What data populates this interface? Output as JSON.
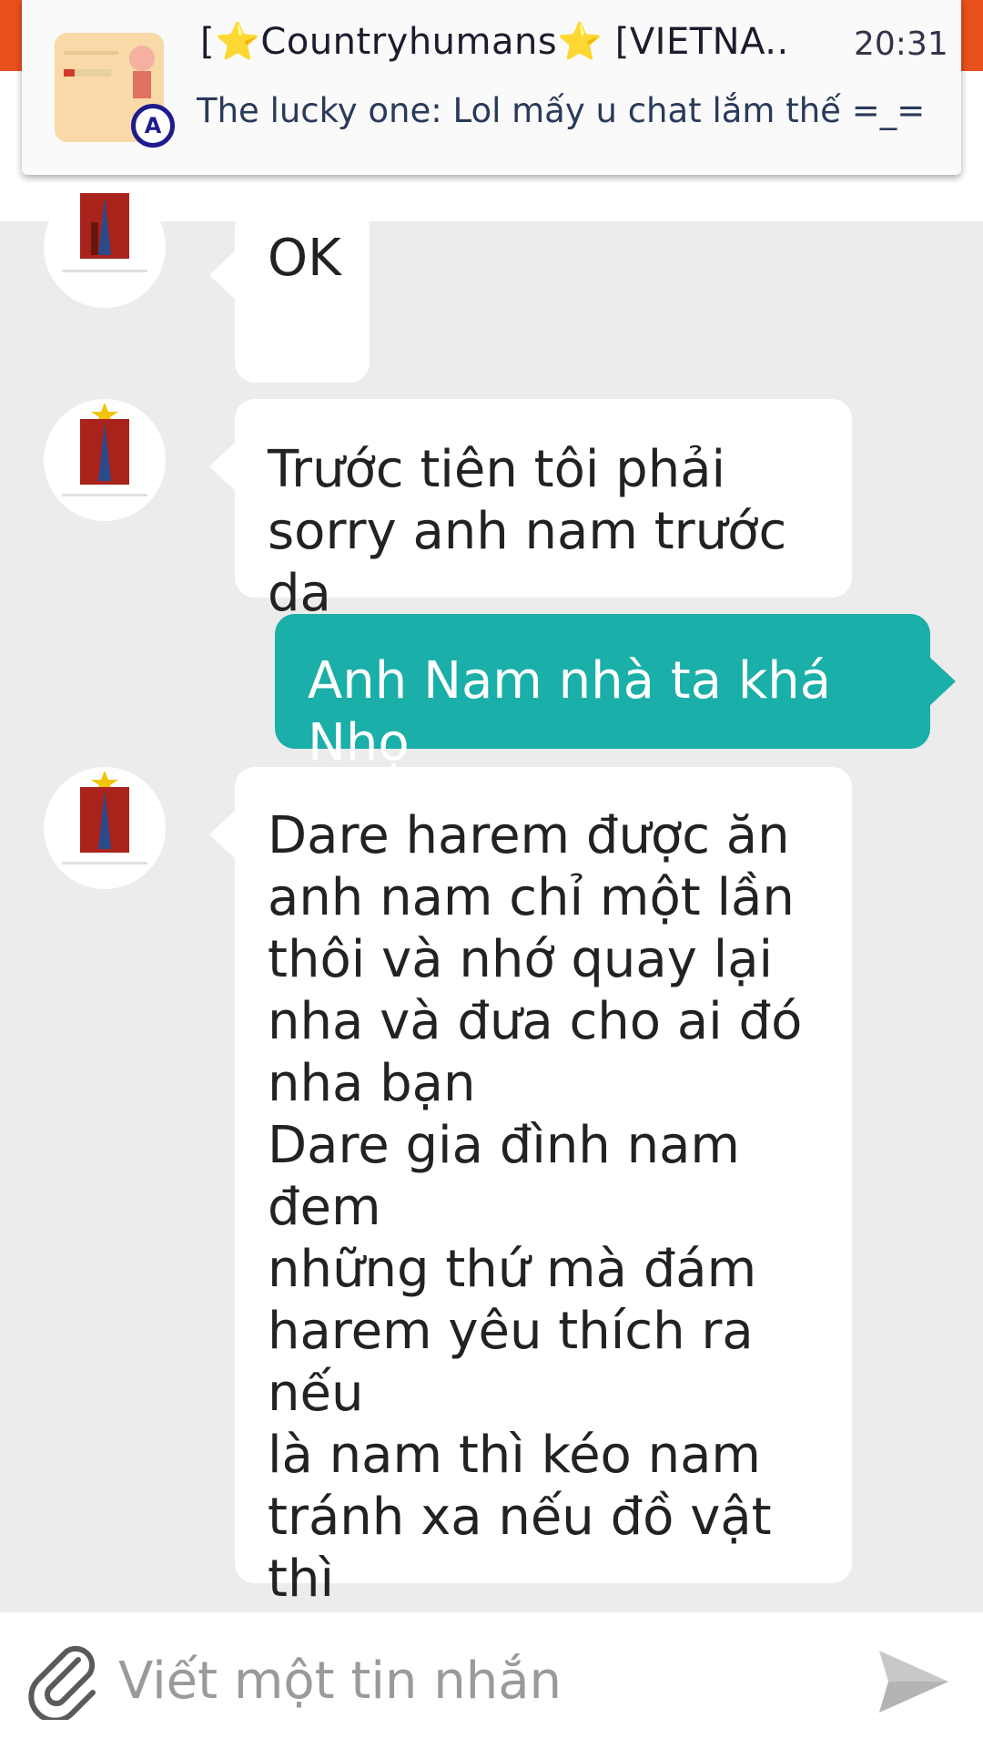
{
  "notification": {
    "title": "[⭐Countryhumans⭐ [VIETNA..",
    "time": "20:31",
    "body": "The lucky one: Lol mấy u chat lắm thế =_=",
    "badge": "A"
  },
  "messages": [
    {
      "direction": "in",
      "text": "OK"
    },
    {
      "direction": "in",
      "text": "Trước tiên tôi phải\nsorry anh nam trước da"
    },
    {
      "direction": "out",
      "text": "Anh Nam nhà ta khá Nhọ"
    },
    {
      "direction": "in",
      "text": "Dare harem được ăn\nanh nam chỉ một lần\nthôi và nhớ quay lại\nnha và đưa cho ai đó\nnha bạn\nDare gia đình nam đem\nnhững thứ mà đám\nharem yêu thích ra nếu\nlà nam thì kéo nam\ntránh xa nếu đồ vật thì\nđặt võ như chơi không\nthương tiếc"
    }
  ],
  "composer": {
    "placeholder": "Viết một tin nhắn",
    "value": ""
  },
  "colors": {
    "accent": "#e8501c",
    "outgoing_bubble": "#1aafa8",
    "background": "#ececec"
  },
  "icons": {
    "attach": "paperclip-icon",
    "send": "send-icon"
  }
}
